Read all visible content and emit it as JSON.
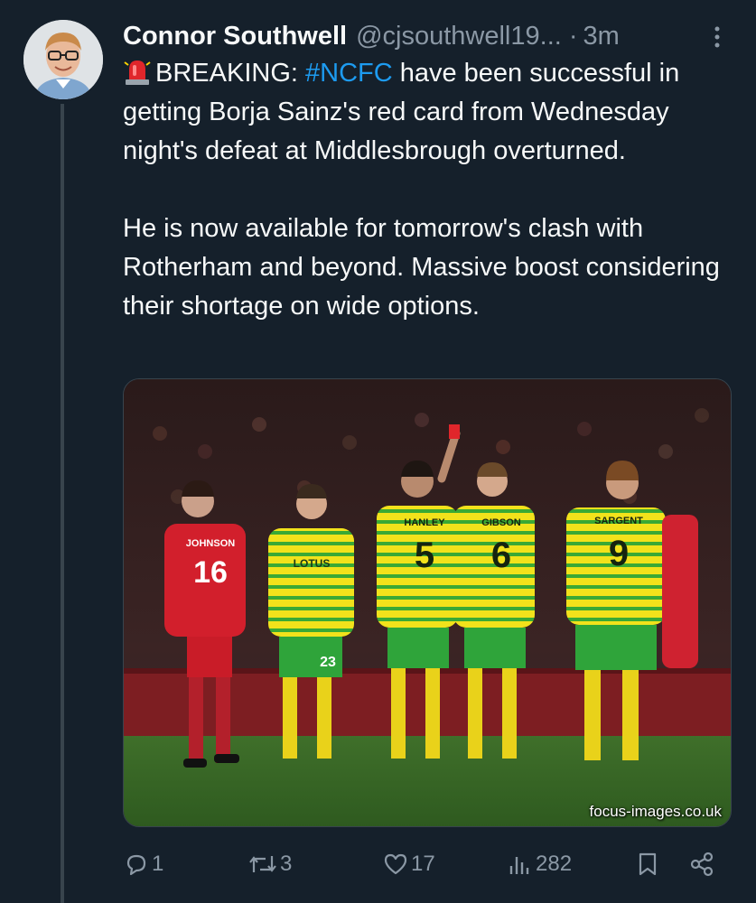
{
  "author": {
    "display_name": "Connor Southwell",
    "handle": "@cjsouthwell19...",
    "separator": "·",
    "time": "3m"
  },
  "tweet": {
    "siren_icon": "police-car-light-emoji",
    "breaking_prefix": "BREAKING: ",
    "hashtag": "#NCFC",
    "line1_rest": " have been successful in getting Borja Sainz's red card from Wednesday night's defeat at Middlesbrough overturned.",
    "paragraph2": "He is now available for tomorrow's clash with Rotherham and beyond. Massive boost considering their shortage on wide options."
  },
  "media": {
    "watermark": "focus-images.co.uk",
    "shirt_numbers": [
      "16",
      "23",
      "5",
      "6",
      "9"
    ],
    "shirt_names": [
      "JOHNSON",
      "HANLEY",
      "GIBSON",
      "SARGENT"
    ],
    "sponsor": "LOTUS"
  },
  "actions": {
    "reply_count": "1",
    "retweet_count": "3",
    "like_count": "17",
    "views_count": "282"
  },
  "colors": {
    "background": "#15202b",
    "text": "#f7f9f9",
    "muted": "#8b98a5",
    "link": "#1d9bf0",
    "thread_line": "#38444d"
  }
}
